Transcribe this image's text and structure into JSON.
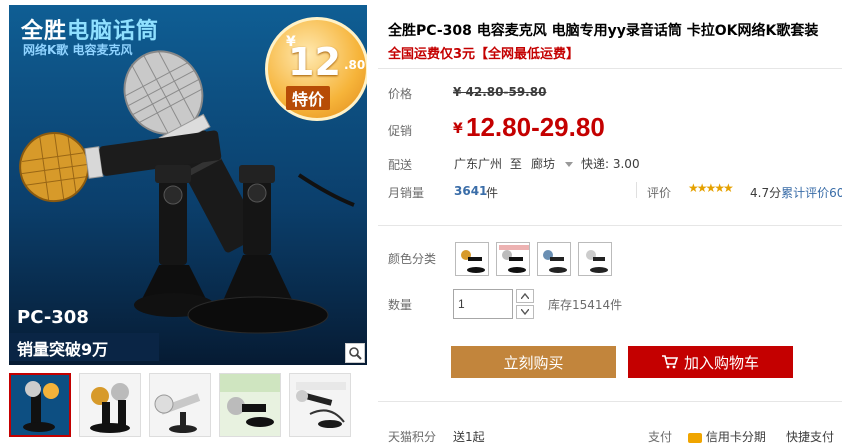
{
  "image": {
    "brand_line_1": "全胜电脑话筒",
    "brand_line_1_white": "全胜",
    "brand_line_1_accent": "电脑话筒",
    "brand_line_2": "网络K歌  电容麦克风",
    "badge_yen": "¥",
    "badge_price": "12",
    "badge_decimal": ".80",
    "badge_tag": "特价",
    "model": "PC-308",
    "sales_banner": "销量突破9万",
    "zoom_icon": "magnifier-icon"
  },
  "thumbnails": [
    {
      "active": true
    },
    {
      "active": false
    },
    {
      "active": false
    },
    {
      "active": false
    },
    {
      "active": false
    }
  ],
  "product": {
    "title": "全胜PC-308 电容麦克风 电脑专用yy录音话筒 卡拉OK网络K歌套装",
    "subtitle": "全国运费仅3元【全网最低运费】"
  },
  "price": {
    "label": "价格",
    "original": "¥ 42.80-59.80"
  },
  "promo": {
    "label": "促销",
    "yen": "¥",
    "value": "12.80-29.80"
  },
  "shipping": {
    "label": "配送",
    "from": "广东广州",
    "to_word": "至",
    "destination": "廊坊",
    "express": "快递: 3.00"
  },
  "monthly": {
    "label": "月销量",
    "count": "3641",
    "unit": "件",
    "review_label": "评价",
    "stars": "★★★★★",
    "score": "4.7分",
    "cumulative": "累计评价60"
  },
  "color": {
    "label": "颜色分类",
    "count": 4
  },
  "quantity": {
    "label": "数量",
    "value": "1",
    "stock": "库存15414件"
  },
  "actions": {
    "buy_now": "立刻购买",
    "add_cart": "加入购物车"
  },
  "footer": {
    "points_label": "天猫积分",
    "points_value": "送1起",
    "pay_label": "支付",
    "credit": "信用卡分期",
    "quick": "快捷支付"
  },
  "colors": {
    "accent_red": "#c40000",
    "buy_brown": "#c2853c",
    "link_blue": "#3a6da8"
  }
}
